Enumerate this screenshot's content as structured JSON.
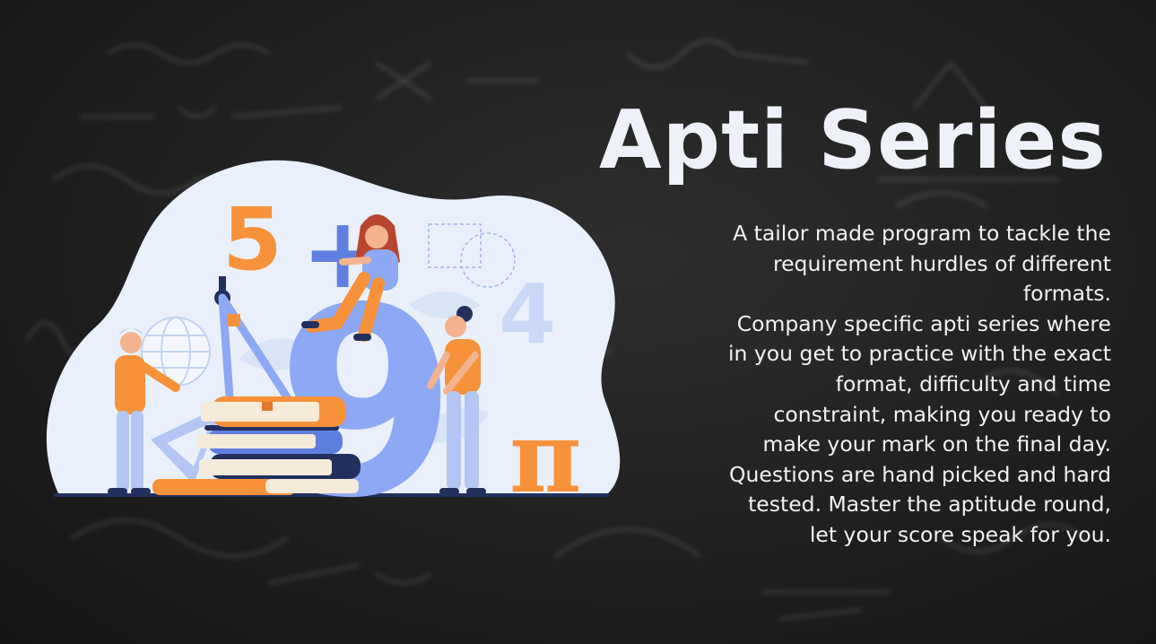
{
  "banner": {
    "title": "Apti Series",
    "description": "A tailor made program to tackle the\nrequirement hurdles of different\nformats.\nCompany specific apti series where\nin you get to practice with the exact\nformat, difficulty and time\nconstraint, making you ready to\nmake  your mark on the final day.\nQuestions are hand picked and hard\ntested. Master the aptitude round,\nlet your score speak for you."
  },
  "illustration": {
    "digit_five": "5",
    "digit_nine": "9",
    "digit_four": "4",
    "pi_symbol": "π",
    "plus_symbol": "+"
  },
  "colors": {
    "background": "#1c1c1c",
    "title": "#eef1f7",
    "text": "#f2f2f2",
    "blob": "#e9f0fb",
    "accent_orange": "#f7913a",
    "accent_blue": "#8da8f5",
    "navy": "#22305e"
  }
}
